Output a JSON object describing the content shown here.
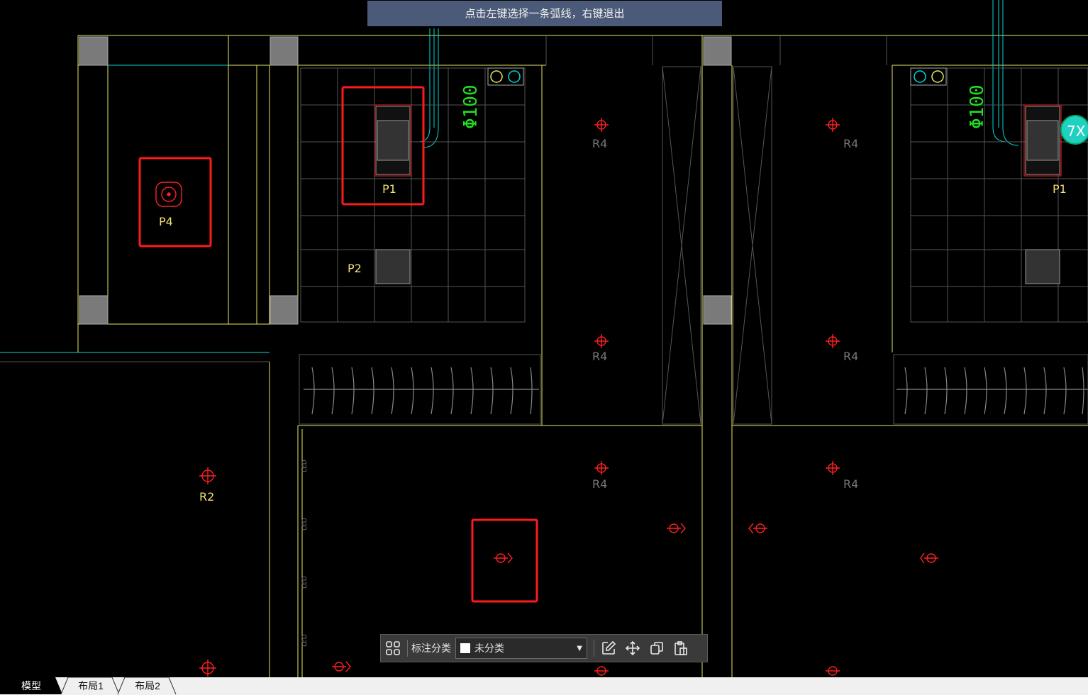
{
  "hint_text": "点击左键选择一条弧线，右键退出",
  "labels": {
    "p4": "P4",
    "p1_left": "P1",
    "p1_right": "P1",
    "p2": "P2",
    "r2": "R2",
    "r4": "R4",
    "led": "LED",
    "phi100": "Φ100"
  },
  "toolbar": {
    "grid_icon": "grid-icon",
    "label": "标注分类",
    "select_value": "未分类",
    "edit_icon": "edit-icon",
    "move_icon": "move-icon",
    "copy_icon": "copy-icon",
    "paste_icon": "paste-icon"
  },
  "tabs": [
    "模型",
    "布局1",
    "布局2"
  ],
  "colors": {
    "wall": "#ffff66",
    "pipe": "#00ffff",
    "fixture": "#ff2020",
    "highlight": "#ff1a1a",
    "label_yellow": "#f0e070",
    "label_gray": "#888888",
    "green": "#22dd22",
    "hint_bg": "#4a5a78"
  }
}
